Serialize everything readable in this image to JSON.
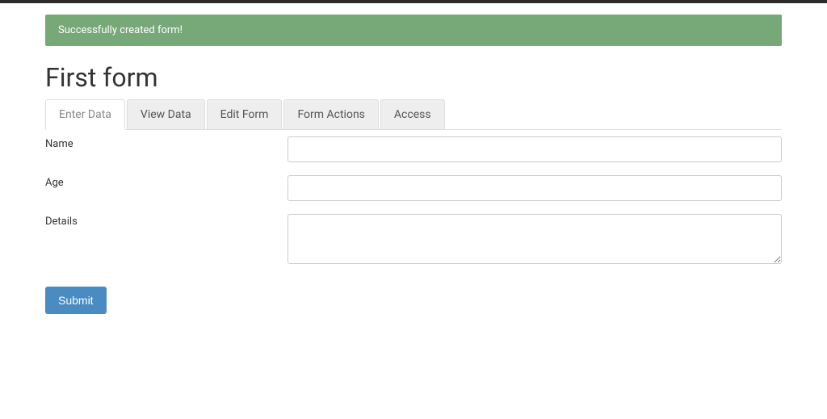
{
  "alert": {
    "message": "Successfully created form!"
  },
  "page": {
    "title": "First form"
  },
  "tabs": [
    {
      "label": "Enter Data",
      "active": true
    },
    {
      "label": "View Data",
      "active": false
    },
    {
      "label": "Edit Form",
      "active": false
    },
    {
      "label": "Form Actions",
      "active": false
    },
    {
      "label": "Access",
      "active": false
    }
  ],
  "form": {
    "fields": [
      {
        "label": "Name",
        "type": "text",
        "value": ""
      },
      {
        "label": "Age",
        "type": "text",
        "value": ""
      },
      {
        "label": "Details",
        "type": "textarea",
        "value": ""
      }
    ],
    "submit_label": "Submit"
  }
}
